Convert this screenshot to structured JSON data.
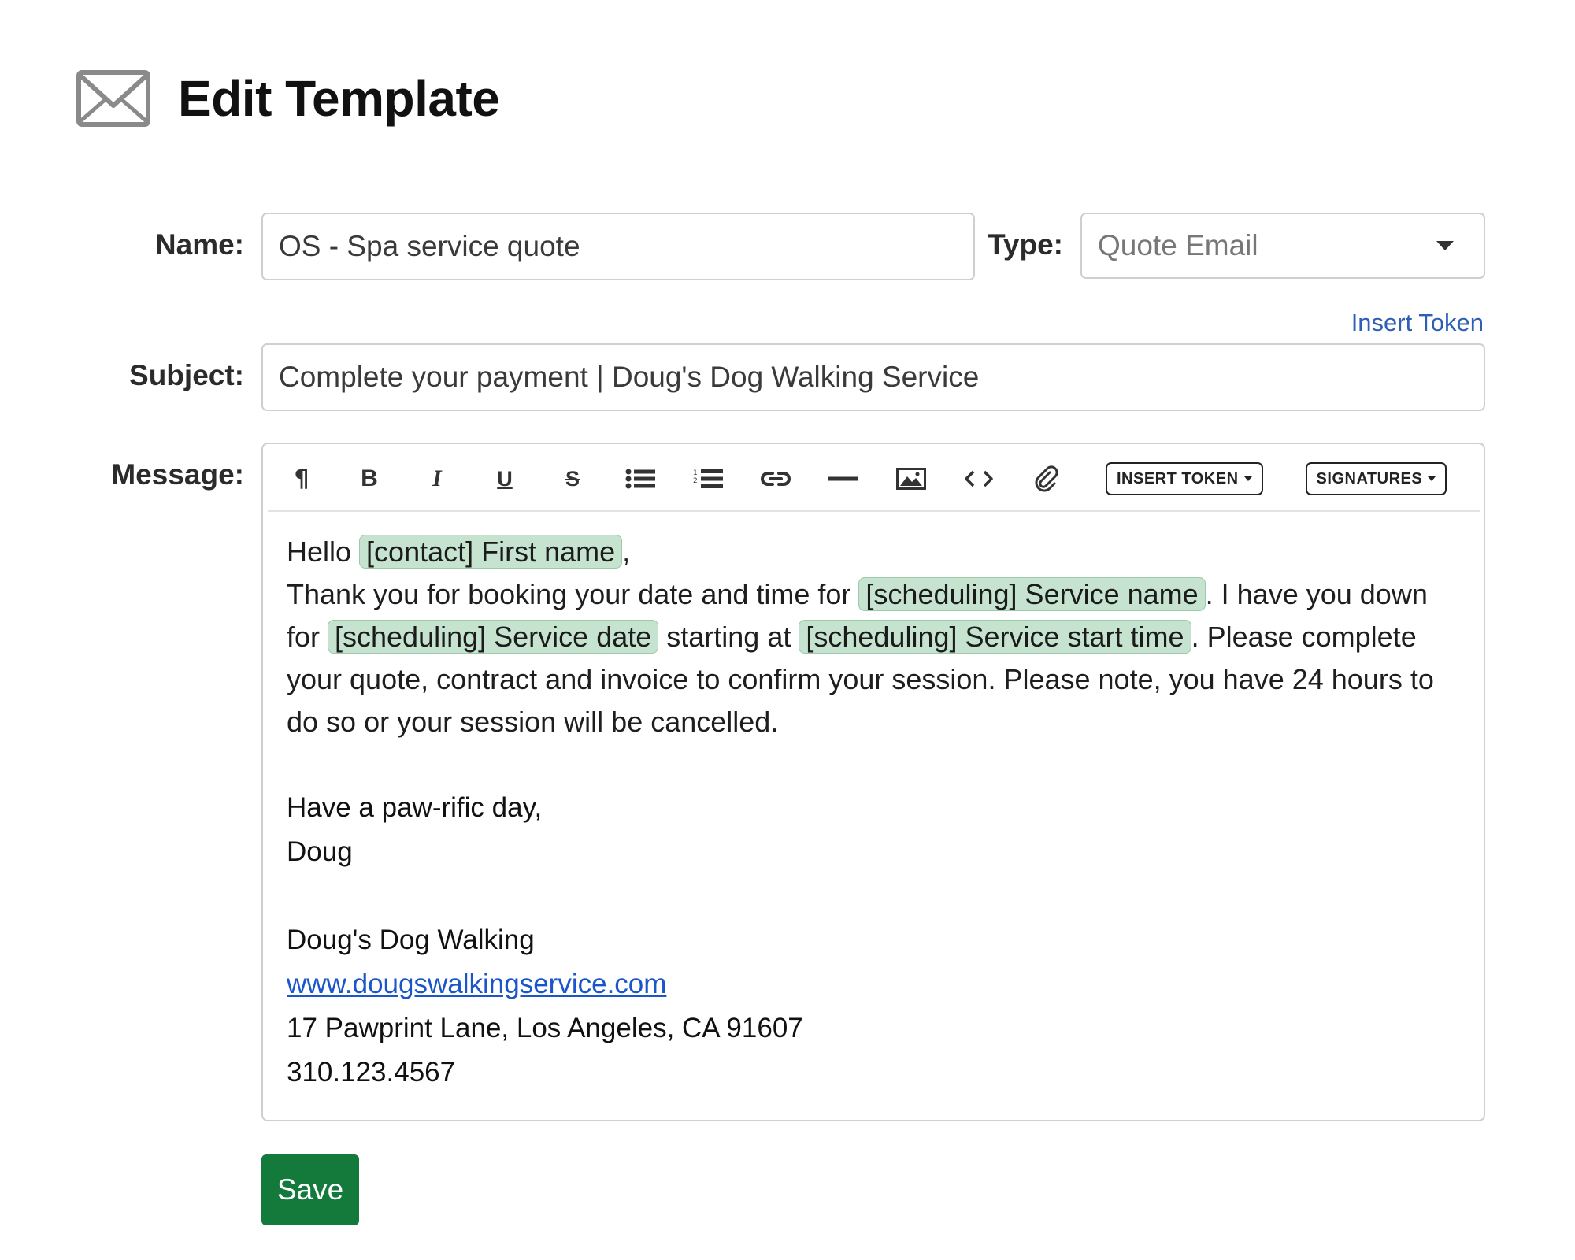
{
  "header": {
    "icon": "envelope-icon",
    "title": "Edit Template"
  },
  "form": {
    "name_label": "Name:",
    "name_value": "OS - Spa service quote",
    "type_label": "Type:",
    "type_value": "Quote Email",
    "insert_token_link": "Insert Token",
    "subject_label": "Subject:",
    "subject_value": "Complete your payment | Doug's Dog Walking Service",
    "message_label": "Message:"
  },
  "toolbar": {
    "buttons": [
      {
        "icon": "paragraph-icon",
        "glyph": "¶"
      },
      {
        "icon": "bold-icon",
        "glyph": "B"
      },
      {
        "icon": "italic-icon",
        "glyph": "I"
      },
      {
        "icon": "underline-icon",
        "glyph": "U"
      },
      {
        "icon": "strikethrough-icon",
        "glyph": "S"
      },
      {
        "icon": "bullet-list-icon"
      },
      {
        "icon": "numbered-list-icon"
      },
      {
        "icon": "link-icon"
      },
      {
        "icon": "horizontal-rule-icon"
      },
      {
        "icon": "image-icon"
      },
      {
        "icon": "code-icon"
      },
      {
        "icon": "attachment-icon"
      }
    ],
    "insert_token_label": "INSERT TOKEN",
    "signatures_label": "SIGNATURES"
  },
  "message": {
    "greeting": "Hello ",
    "token_first_name": "[contact] First name",
    "greeting_end": ",",
    "p1_a": "Thank you for booking your date and time for ",
    "token_service_name": "[scheduling] Service name",
    "p1_b": ". I have you down for ",
    "token_service_date": "[scheduling] Service date",
    "p1_c": " starting at ",
    "token_service_start": "[scheduling] Service start time",
    "p1_d": ". Please complete your quote, contract and invoice to confirm your session. Please note, you have 24 hours to do so or your session will be cancelled.",
    "closing": "Have a paw-rific day,",
    "sender": "Doug",
    "business_name": "Doug's Dog Walking",
    "website": "www.dougswalkingservice.com",
    "address": "17 Pawprint Lane, Los Angeles, CA 91607",
    "phone": "310.123.4567"
  },
  "actions": {
    "save_label": "Save",
    "save_color": "#137a3b"
  },
  "colors": {
    "token_bg": "#c5e3cf",
    "link": "#1a56c9"
  }
}
